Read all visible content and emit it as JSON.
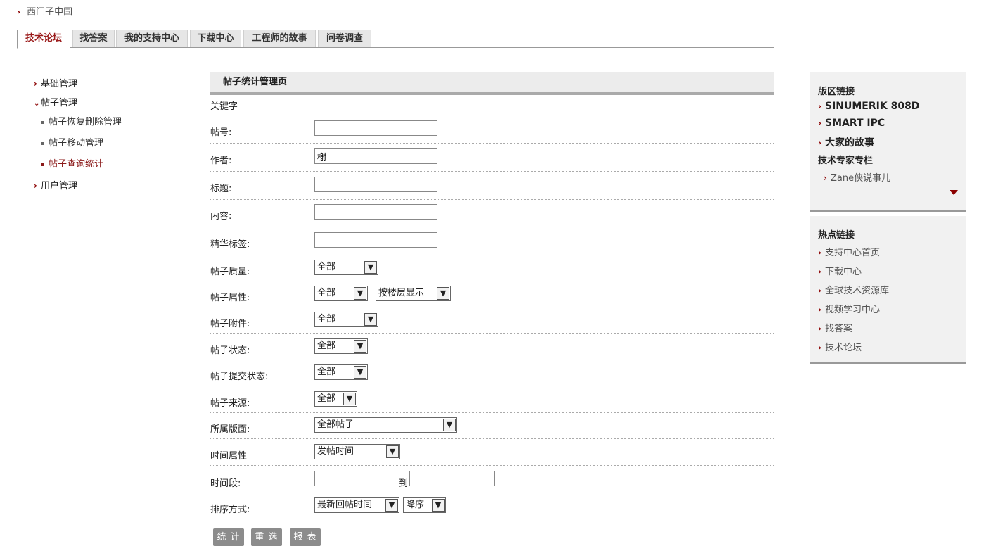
{
  "breadcrumb": {
    "label": "西门子中国"
  },
  "tabs": [
    "技术论坛",
    "找答案",
    "我的支持中心",
    "下载中心",
    "工程师的故事",
    "问卷调查"
  ],
  "nav": {
    "basic": "基础管理",
    "posts": "帖子管理",
    "sub": [
      "帖子恢复删除管理",
      "帖子移动管理",
      "帖子查询统计"
    ],
    "users": "用户管理"
  },
  "form": {
    "header": "帖子统计管理页",
    "keyword_label": "关键字",
    "post_no": {
      "label": "帖号:",
      "value": ""
    },
    "author": {
      "label": "作者:",
      "value": "榭"
    },
    "title": {
      "label": "标题:",
      "value": ""
    },
    "content": {
      "label": "内容:",
      "value": ""
    },
    "tag": {
      "label": "精华标签:",
      "value": ""
    },
    "quality": {
      "label": "帖子质量:",
      "value": "全部"
    },
    "attribute": {
      "label": "帖子属性:",
      "value": "全部",
      "display": "按楼层显示"
    },
    "attachment": {
      "label": "帖子附件:",
      "value": "全部"
    },
    "status": {
      "label": "帖子状态:",
      "value": "全部"
    },
    "submit_status": {
      "label": "帖子提交状态:",
      "value": "全部"
    },
    "source": {
      "label": "帖子来源:",
      "value": "全部"
    },
    "board": {
      "label": "所属版面:",
      "value": "全部帖子"
    },
    "time_attr": {
      "label": "时间属性",
      "value": "发帖时间"
    },
    "time_range": {
      "label": "时间段:",
      "from": "",
      "to_label": "到",
      "to": ""
    },
    "sort": {
      "label": "排序方式:",
      "value": "最新回帖时间",
      "order": "降序"
    },
    "buttons": {
      "stat": "统 计",
      "reset": "重 选",
      "report": "报 表"
    }
  },
  "right": {
    "board_links_title": "版区链接",
    "board_links": [
      "SINUMERIK 808D",
      "SMART IPC",
      "大家的故事"
    ],
    "expert_title": "技术专家专栏",
    "expert_links": [
      "Zane侠说事儿"
    ],
    "hot_title": "热点链接",
    "hot_links": [
      "支持中心首页",
      "下载中心",
      "全球技术资源库",
      "视频学习中心",
      "找答案",
      "技术论坛"
    ]
  },
  "colors": {
    "accent": "#8b0000",
    "button": "#8c8c8c",
    "panel": "#f1f1f1"
  }
}
